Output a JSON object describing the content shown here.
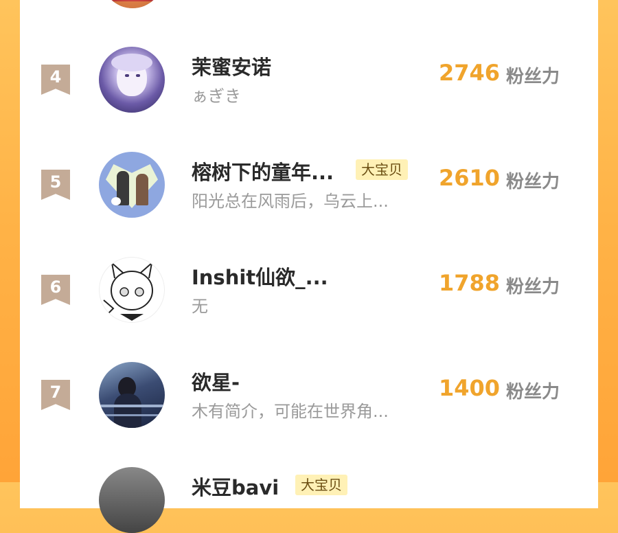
{
  "colors": {
    "background": "#ffb347",
    "card": "#ffffff",
    "rank_badge": "#c4ab97",
    "score": "#f0a42c",
    "tag_bg": "#fff1b6"
  },
  "score_unit": "粉丝力",
  "ranking": [
    {
      "rank": "4",
      "name": "茉蜜安诺",
      "tag": "",
      "bio": "ぁぎき",
      "score": "2746"
    },
    {
      "rank": "5",
      "name": "榕树下的童年...",
      "tag": "大宝贝",
      "bio": "阳光总在风雨后，乌云上...",
      "score": "2610"
    },
    {
      "rank": "6",
      "name": "Inshit仙欲_...",
      "tag": "",
      "bio": "无",
      "score": "1788"
    },
    {
      "rank": "7",
      "name": "欲星-",
      "tag": "",
      "bio": "木有简介，可能在世界角...",
      "score": "1400"
    },
    {
      "rank": "",
      "name": "米豆bavi",
      "tag": "大宝贝",
      "bio": "",
      "score": ""
    }
  ]
}
